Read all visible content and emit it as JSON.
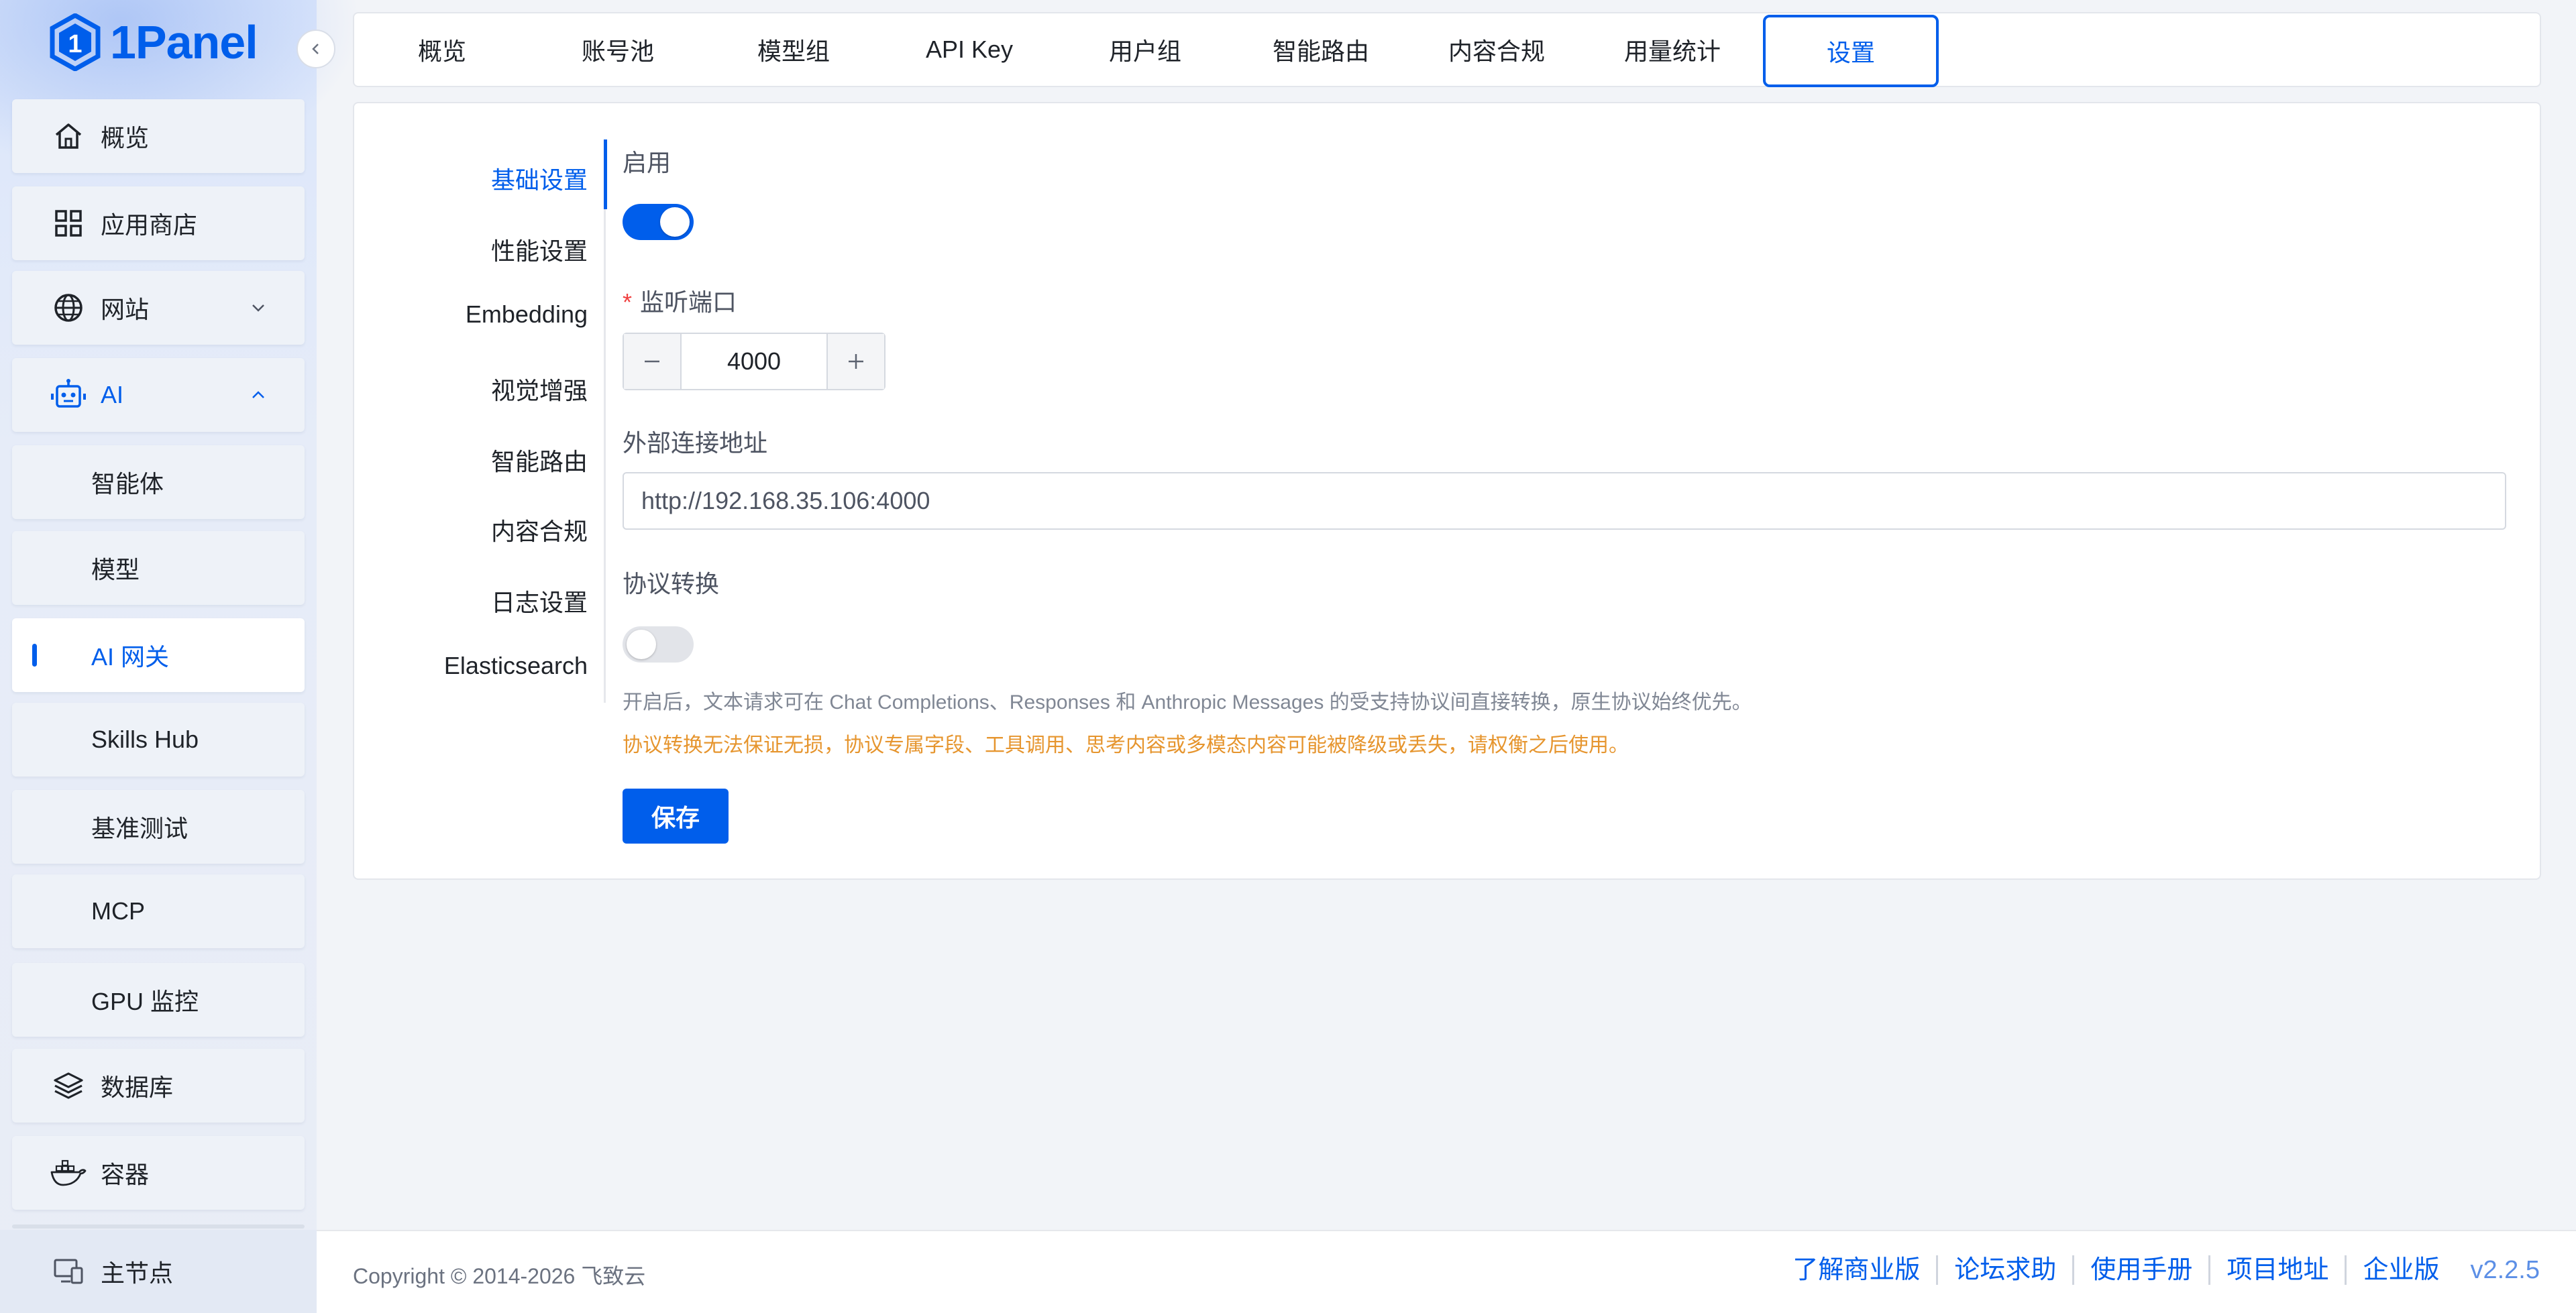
{
  "brand": {
    "logo_text": "1Panel"
  },
  "colors": {
    "primary": "#005eeb",
    "warning": "#e6952e"
  },
  "sidebar": {
    "items": [
      {
        "label": "概览",
        "icon": "home-icon"
      },
      {
        "label": "应用商店",
        "icon": "grid-icon"
      },
      {
        "label": "网站",
        "icon": "globe-icon"
      },
      {
        "label": "AI",
        "icon": "robot-icon"
      },
      {
        "label": "智能体"
      },
      {
        "label": "模型"
      },
      {
        "label": "AI 网关"
      },
      {
        "label": "Skills Hub"
      },
      {
        "label": "基准测试"
      },
      {
        "label": "MCP"
      },
      {
        "label": "GPU 监控"
      },
      {
        "label": "数据库",
        "icon": "layers-icon"
      },
      {
        "label": "容器",
        "icon": "docker-icon"
      }
    ],
    "node": {
      "label": "主节点",
      "icon": "monitor-icon"
    }
  },
  "tabs": [
    "概览",
    "账号池",
    "模型组",
    "API Key",
    "用户组",
    "智能路由",
    "内容合规",
    "用量统计",
    "设置"
  ],
  "anchors": [
    "基础设置",
    "性能设置",
    "Embedding",
    "视觉增强",
    "智能路由",
    "内容合规",
    "日志设置",
    "Elasticsearch"
  ],
  "form": {
    "enable_label": "启用",
    "enable_on": true,
    "port_label": "监听端口",
    "port_value": "4000",
    "url_label": "外部连接地址",
    "url_value": "http://192.168.35.106:4000",
    "protocol_label": "协议转换",
    "protocol_on": false,
    "protocol_hint": "开启后，文本请求可在 Chat Completions、Responses 和 Anthropic Messages 的受支持协议间直接转换，原生协议始终优先。",
    "protocol_warning": "协议转换无法保证无损，协议专属字段、工具调用、思考内容或多模态内容可能被降级或丢失，请权衡之后使用。",
    "save_label": "保存"
  },
  "footer": {
    "copyright": "Copyright © 2014-2026 飞致云",
    "links": [
      "了解商业版",
      "论坛求助",
      "使用手册",
      "项目地址",
      "企业版"
    ],
    "version": "v2.2.5"
  }
}
